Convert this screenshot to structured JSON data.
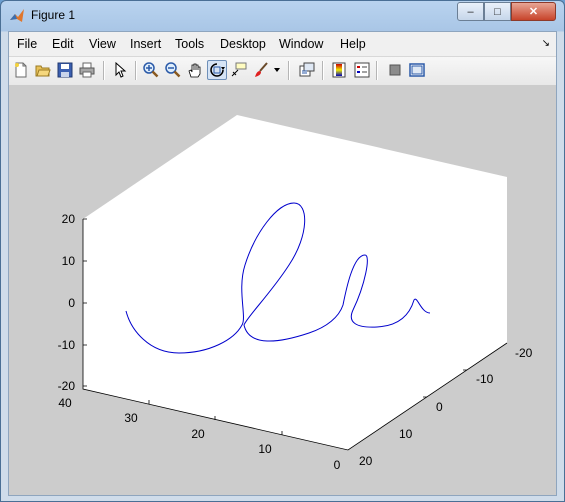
{
  "window": {
    "title": "Figure 1",
    "controls": {
      "minimize": "–",
      "maximize": "□",
      "close": "✕"
    }
  },
  "menubar": {
    "items": [
      "File",
      "Edit",
      "View",
      "Insert",
      "Tools",
      "Desktop",
      "Window",
      "Help"
    ],
    "dock_arrow": "↘"
  },
  "toolbar": {
    "icons": [
      "new-figure-icon",
      "open-file-icon",
      "save-icon",
      "print-icon",
      "pointer-arrow-icon",
      "zoom-in-icon",
      "zoom-out-icon",
      "pan-hand-icon",
      "rotate-3d-icon",
      "data-cursor-icon",
      "brush-icon",
      "brush-dropdown-icon",
      "link-plot-icon",
      "colorbar-icon",
      "legend-icon",
      "hide-plot-tools-icon",
      "show-plot-tools-icon"
    ],
    "active_icon": "rotate-3d-icon"
  },
  "plot": {
    "z_ticks": [
      "20",
      "10",
      "0",
      "-10",
      "-20"
    ],
    "y_ticks": [
      "40",
      "30",
      "20",
      "10",
      "0"
    ],
    "x_ticks": [
      "-20",
      "-10",
      "0",
      "10",
      "20"
    ],
    "line_color": "#0000cc",
    "axes_background": "#ffffff",
    "figure_background": "#cccccc"
  },
  "colors": {
    "title_bar": "#b9d3ef",
    "close_button": "#c7432a"
  }
}
